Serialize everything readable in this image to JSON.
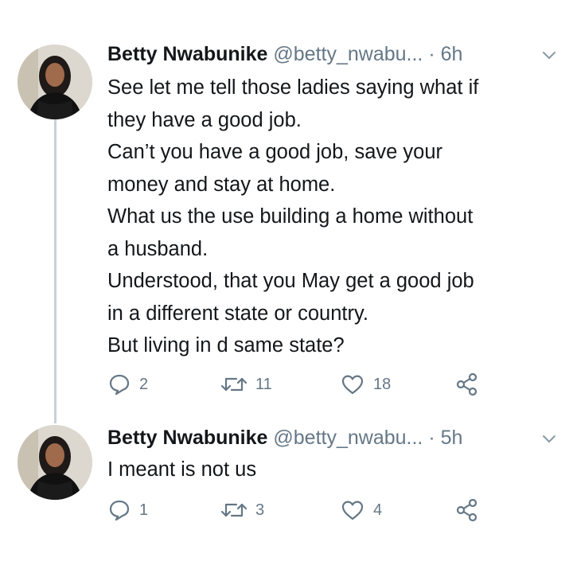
{
  "tweets": [
    {
      "author_name": "Betty Nwabunike",
      "handle": "@betty_nwabu...",
      "time": "· 6h",
      "body_lines": [
        "See let me tell those ladies saying what if",
        "they have a good job.",
        "Can’t you  have a good job, save your",
        "money and stay at home.",
        "What us the use building a home without",
        "a husband.",
        "Understood, that you May get a good job",
        "in a different state or country.",
        "But living in d same state?"
      ],
      "replies": "2",
      "retweets": "11",
      "likes": "18"
    },
    {
      "author_name": "Betty Nwabunike",
      "handle": "@betty_nwabu...",
      "time": "· 5h",
      "body_lines": [
        "I meant is not us"
      ],
      "replies": "1",
      "retweets": "3",
      "likes": "4"
    }
  ],
  "icons": {
    "reply": "reply-icon",
    "retweet": "retweet-icon",
    "like": "heart-icon",
    "share": "share-icon",
    "menu": "chevron-down-icon"
  },
  "colors": {
    "text": "#14171a",
    "secondary": "#657786",
    "thread_line": "#c8d0d6"
  }
}
